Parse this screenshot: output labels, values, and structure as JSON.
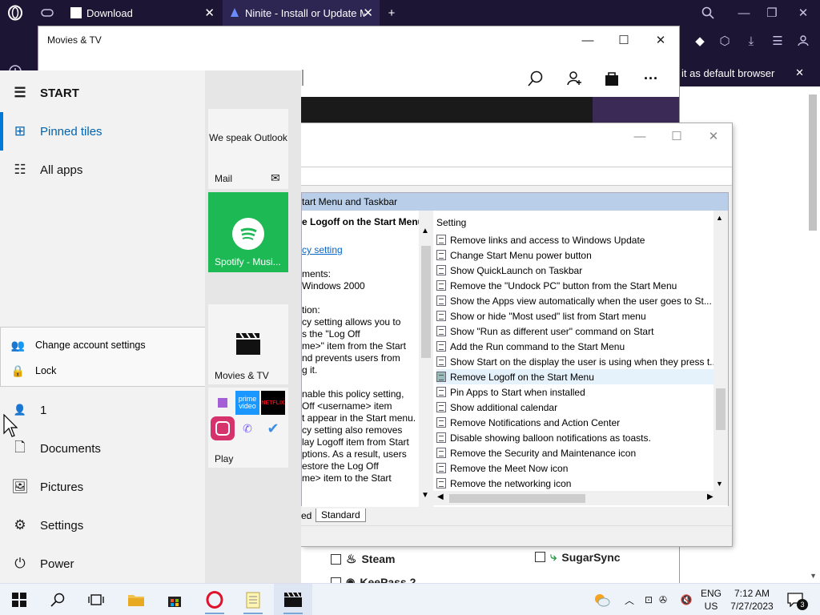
{
  "opera": {
    "tabs": [
      {
        "label": "Download",
        "active": false
      },
      {
        "label": "Ninite - Install or Update M",
        "active": true
      }
    ],
    "new_tab": "+",
    "default_banner": "it as default browser"
  },
  "movies_tv": {
    "title": "Movies & TV"
  },
  "gpedit": {
    "banner": "tart Menu and Taskbar",
    "left_title": "e Logoff on the Start Menu",
    "left_link": "cy setting",
    "left_lines": [
      "ments:",
      "Windows 2000",
      "",
      "tion:",
      "cy setting allows you to",
      "s the \"Log Off",
      "me>\" item from the Start",
      "nd prevents users from",
      "g it.",
      "",
      "nable this policy setting,",
      "Off <username> item",
      "t appear in the Start menu.",
      "cy setting also removes",
      "lay Logoff item from Start",
      "ptions. As a result, users",
      "estore the Log Off",
      "me> item to the Start"
    ],
    "column_header": "Setting",
    "settings": [
      "Remove links and access to Windows Update",
      "Change Start Menu power button",
      "Show QuickLaunch on Taskbar",
      "Remove the \"Undock PC\" button from the Start Menu",
      "Show the Apps view automatically when the user goes to St...",
      "Show or hide \"Most used\" list from Start menu",
      "Show \"Run as different user\" command on Start",
      "Add the Run command to the Start Menu",
      "Show Start on the display the user is using when they press t...",
      "Remove Logoff on the Start Menu",
      "Pin Apps to Start when installed",
      "Show additional calendar",
      "Remove Notifications and Action Center",
      "Disable showing balloon notifications as toasts.",
      "Remove the Security and Maintenance icon",
      "Remove the Meet Now icon",
      "Remove the networking icon"
    ],
    "selected_index": 9,
    "tabs": [
      "ed",
      "Standard"
    ]
  },
  "ninite": {
    "items": [
      "Steam",
      "SugarSync",
      "KeePass 2"
    ]
  },
  "start_menu": {
    "header": "START",
    "nav": [
      "Pinned tiles",
      "All apps"
    ],
    "account_menu": [
      "Change account settings",
      "Lock"
    ],
    "user": "1",
    "places": [
      "Documents",
      "Pictures",
      "Settings",
      "Power"
    ],
    "tiles": {
      "outlook_text": "We speak Outlook",
      "mail": "Mail",
      "spotify": "Spotify - Musi...",
      "movies": "Movies & TV",
      "play": "Play",
      "prime": "prime video",
      "netflix": "NETFLIX"
    }
  },
  "taskbar": {
    "lang_top": "ENG",
    "lang_bottom": "US",
    "time": "7:12 AM",
    "date": "7/27/2023",
    "notifications": "3"
  },
  "colors": {
    "opera_bg": "#1c1533",
    "spotify_green": "#1db954",
    "accent_blue": "#0078d7"
  }
}
